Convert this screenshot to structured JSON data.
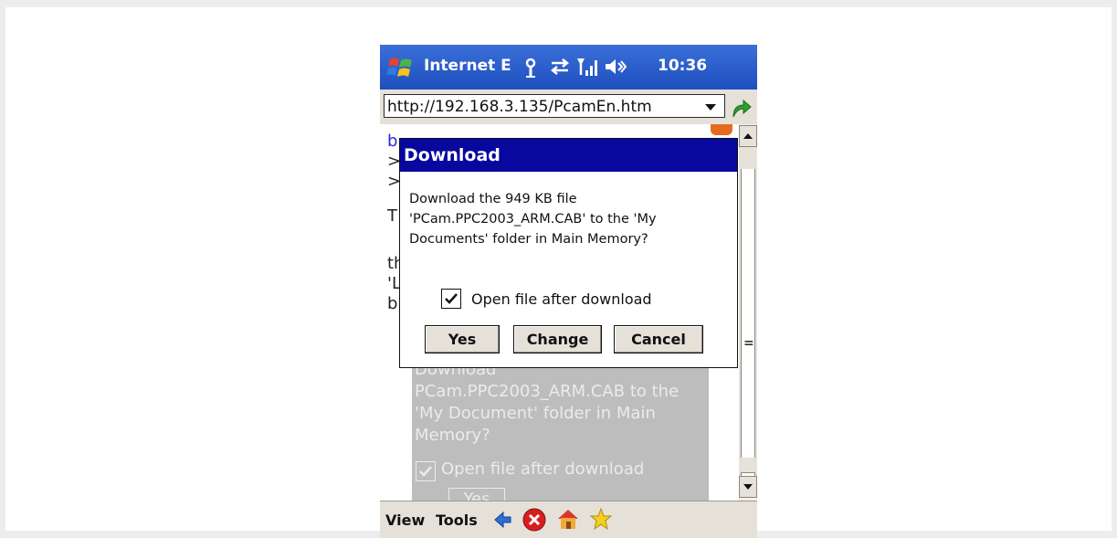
{
  "titlebar": {
    "title": "Internet E",
    "time": "10:36",
    "icons": [
      "windows-start-icon",
      "antenna-icon",
      "sync-icon",
      "signal-strength-icon",
      "speaker-icon"
    ]
  },
  "address_bar": {
    "url": "http://192.168.3.135/PcamEn.htm",
    "icons": [
      "dropdown-arrow-icon",
      "go-arrow-icon"
    ]
  },
  "page": {
    "partial_lines": [
      "b",
      ">",
      ">",
      "T",
      "th",
      "'L",
      "b"
    ],
    "ghost_text_lines": [
      "Download",
      "PCam.PPC2003_ARM.CAB to the",
      "'My Document' folder in Main",
      "Memory?"
    ],
    "ghost_checkbox_label": "Open file after download",
    "ghost_yes": "Yes"
  },
  "dialog": {
    "title": "Download",
    "message_lines": [
      "Download the 949 KB file",
      "'PCam.PPC2003_ARM.CAB' to the 'My",
      "Documents' folder in Main Memory?"
    ],
    "checkbox_label": "Open file after download",
    "checkbox_checked": true,
    "buttons": {
      "yes": "Yes",
      "change": "Change",
      "cancel": "Cancel"
    }
  },
  "bottom_bar": {
    "menu": {
      "view": "View",
      "tools": "Tools"
    },
    "icons": [
      "back-icon",
      "stop-icon",
      "home-icon",
      "favorites-icon"
    ]
  },
  "colors": {
    "titlebar": "#1f4fbf",
    "dialog_title": "#08089e",
    "chrome": "#e5e1d9"
  }
}
